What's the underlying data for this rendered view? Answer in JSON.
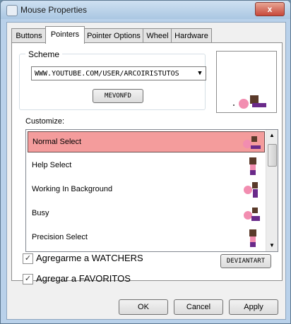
{
  "window": {
    "title": "Mouse Properties",
    "close_label": "x"
  },
  "tabs": [
    {
      "label": "Buttons"
    },
    {
      "label": "Pointers"
    },
    {
      "label": "Pointer Options"
    },
    {
      "label": "Wheel"
    },
    {
      "label": "Hardware"
    }
  ],
  "scheme": {
    "label": "Scheme",
    "selected": "WWW.YOUTUBE.COM/USER/ARCOIRISTUTOS",
    "button_label": "MEVONFD"
  },
  "customize": {
    "label": "Customize:",
    "items": [
      {
        "label": "Normal Select",
        "selected": true,
        "icon": "girl-fan-cursor-icon"
      },
      {
        "label": "Help Select",
        "selected": false,
        "icon": "girl-standing-cursor-icon"
      },
      {
        "label": "Working In Background",
        "selected": false,
        "icon": "girl-fan-cursor-icon"
      },
      {
        "label": "Busy",
        "selected": false,
        "icon": "girl-fan-cursor-icon"
      },
      {
        "label": "Precision Select",
        "selected": false,
        "icon": "girl-standing-cursor-icon"
      }
    ]
  },
  "options": {
    "watchers_label": "Agregarme a WATCHERS",
    "watchers_checked": true,
    "favorites_label": "Agregar a FAVORITOS",
    "favorites_checked": true,
    "deviantart_label": "DEVIANTART"
  },
  "footer": {
    "ok": "OK",
    "cancel": "Cancel",
    "apply": "Apply"
  },
  "colors": {
    "selection": "#f49c9c",
    "window_frame": "#b9d1ea"
  }
}
